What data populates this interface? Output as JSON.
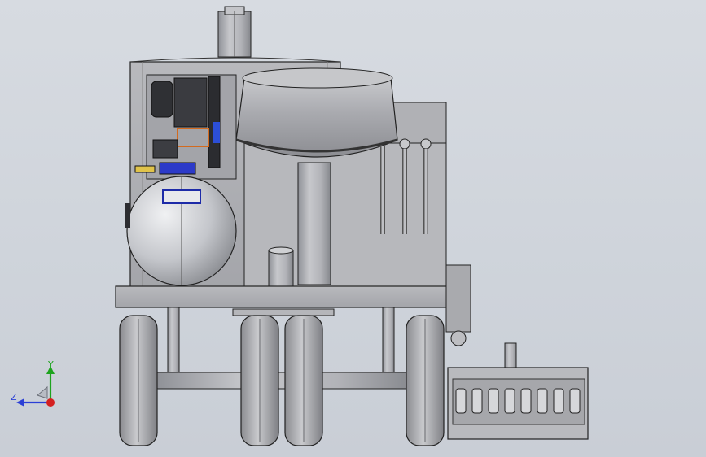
{
  "viewport": {
    "background_top": "#d7dbe1",
    "background_bottom": "#c9ced6"
  },
  "model": {
    "components": [
      "mixing-tank",
      "air-compressor-motor",
      "air-receiver-tank",
      "hopper-bowl",
      "delivery-hoses",
      "trailer-chassis",
      "wheels",
      "axle",
      "manifold-valves"
    ]
  },
  "triad": {
    "x_label": "",
    "y_label": "Y",
    "z_label": "Z",
    "colors": {
      "x": "#d42020",
      "y": "#1ea31e",
      "z": "#2a3fd6"
    }
  }
}
